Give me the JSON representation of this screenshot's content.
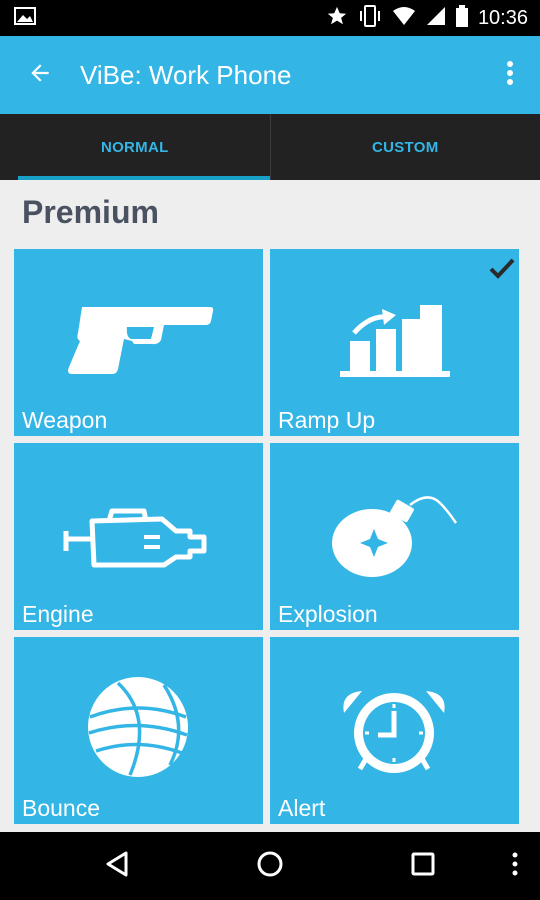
{
  "status_bar": {
    "time": "10:36",
    "icons": [
      "image-icon",
      "star-icon",
      "vibrate-icon",
      "wifi-icon",
      "signal-icon",
      "battery-icon"
    ]
  },
  "app_bar": {
    "title": "ViBe: Work Phone",
    "background": "#33B5E5"
  },
  "tabs": [
    {
      "label": "NORMAL",
      "active": true
    },
    {
      "label": "CUSTOM",
      "active": false
    }
  ],
  "section": {
    "title": "Premium"
  },
  "tiles": [
    {
      "label": "Weapon",
      "icon": "gun-icon",
      "selected": false
    },
    {
      "label": "Ramp Up",
      "icon": "bar-chart-icon",
      "selected": true
    },
    {
      "label": "Engine",
      "icon": "engine-icon",
      "selected": false
    },
    {
      "label": "Explosion",
      "icon": "bomb-icon",
      "selected": false
    },
    {
      "label": "Bounce",
      "icon": "basketball-icon",
      "selected": false
    },
    {
      "label": "Alert",
      "icon": "alarm-clock-icon",
      "selected": false
    }
  ],
  "colors": {
    "accent": "#33B5E5",
    "tab_bar": "#222222",
    "section_title": "#4A5262"
  }
}
